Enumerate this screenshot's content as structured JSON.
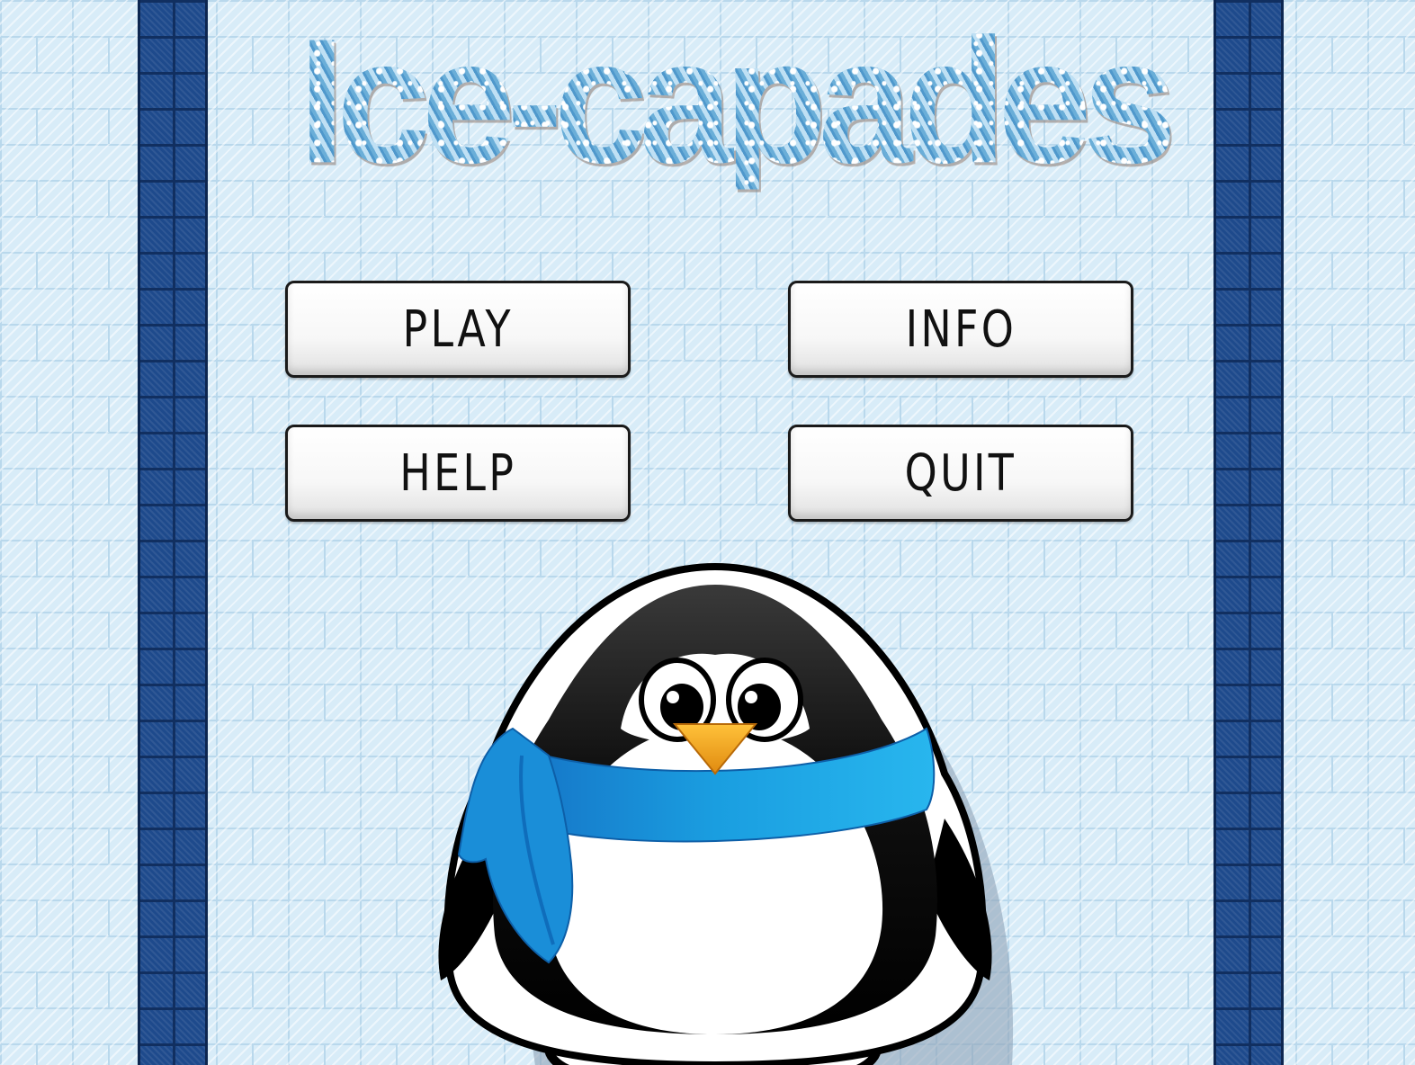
{
  "game": {
    "title": "Ice-capades"
  },
  "menu": {
    "play_label": "PLAY",
    "info_label": "INFO",
    "help_label": "HELP",
    "quit_label": "QUIT"
  },
  "colors": {
    "background": "#d8ecf8",
    "pillar": "#1e4a8c",
    "title_ice": "#8ec6e6",
    "scarf": "#1a9ee0",
    "beak": "#f2a51a"
  },
  "icons": {
    "mascot": "penguin-with-scarf"
  }
}
